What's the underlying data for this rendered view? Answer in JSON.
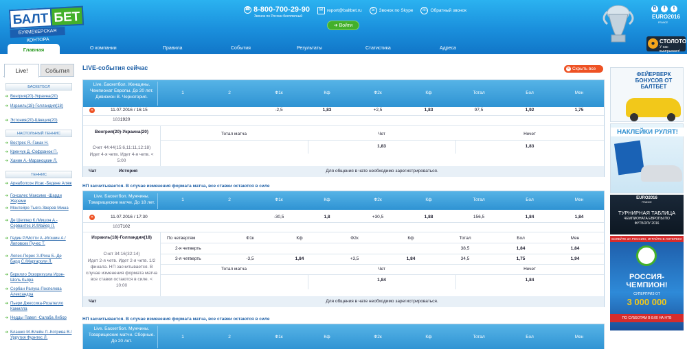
{
  "header": {
    "logo_word1": "БАЛТ",
    "logo_word2": "БЕТ",
    "logo_sub": "БУКМЕКЕРСКАЯ КОНТОРА",
    "phone": "8-800-700-29-90",
    "phone_note": "Звонок по России бесплатный",
    "email": "report@baltbet.ru",
    "skype": "Звонок по Skype",
    "callback": "Обратный звонок",
    "login": "➔ Войти",
    "euro": "EURO2016",
    "euro_country": "FRANCE",
    "stoloto": "СТОЛОТО",
    "stoloto_slogan": "У нас выигрывают!",
    "social": [
      "B",
      "f",
      "t"
    ]
  },
  "nav": {
    "items": [
      "Главная",
      "О компании",
      "Правила",
      "События",
      "Результаты",
      "Статистика",
      "Адреса"
    ]
  },
  "sidebar": {
    "tab_live": "Live!",
    "tab_events": "События",
    "cat_basketball": "БАСКЕТБОЛ",
    "basketball": [
      "Венгрия(20)-Украина(20)",
      "Израиль(18)-Голландия(18)",
      "Эстония(20)-Швеция(20)"
    ],
    "cat_tabletennis": "НАСТОЛЬНЫЙ ТЕННИС",
    "tabletennis": [
      "Вострес Я.-Ганак Н.",
      "Кренчук Д.-Софранюк П.",
      "Ханин А.-Мараноцкин Л."
    ],
    "cat_tennis": "ТЕННИС",
    "tennis": [
      "Арнаболсон Исак -Бедене Аляж",
      "Гонсалес Максимо -Шарди Жереми",
      "Монтейро Тьяго-Зверев Миша",
      "Де Шеппер К./Мишон А.-Сервантес И./Майер Л.",
      "Гедин Р./Мотти А.-Игошин А./Липовсек Пучес Т.",
      "Лопес-Перес З./Роха Б.-Де Бард С./Маргароли Л.",
      "Бурилло Эскорихуэла Ирэн-Шоль Кьяра",
      "Сербан Ралука-Поспелова Александра",
      "Пьери Джессика-Розателло Камилла",
      "Недды Павел -Салаба Либор",
      "Блашко М./Клейн Л.-Котрива В./Уррутия Фуэнтес Л."
    ]
  },
  "main": {
    "title": "LIVE-события сейчас",
    "hide_all": "Скрыть все",
    "cols": [
      "1",
      "2",
      "Ф1к",
      "Кф",
      "Ф2к",
      "Кф",
      "Тотал",
      "Бол",
      "Мен"
    ],
    "ev1": {
      "name": "Live. Баскетбол. Женщины. Чемпионат Европы. До 20 лет. Дивизион В. Черногория.",
      "date": "11.07.2016 / 16:15",
      "vals": [
        "-2,5",
        "1,83",
        "+2,5",
        "1,83",
        "97,5",
        "1,92",
        "1,75"
      ],
      "id1": "183",
      "id2": "1920",
      "match": "Венгрия(20)-Украина(20)",
      "score": "Счет 44:44(15:6,11:11,12:18)",
      "status": "Идет 4-я четв. Идет 4-я четв. < 5:00",
      "total_label": "Тотал матча",
      "even_label": "Чет",
      "odd_label": "Нечет",
      "even": "1,83",
      "odd": "1,83",
      "chat": "Чат",
      "history": "История",
      "chat_msg": "Для общения в чате необходимо зарегистрироваться."
    },
    "note": "НП засчитывается. В случае изменения формата матча, все ставки остаются в силе",
    "ev2": {
      "name": "Live. Баскетбол. Мужчины. Товарищеские матчи. До 18 лет.",
      "date": "11.07.2016 / 17:30",
      "vals": [
        "-30,5",
        "1,8",
        "+30,5",
        "1,88",
        "156,5",
        "1,84",
        "1,84"
      ],
      "id1": "183",
      "id2": "7102",
      "match": "Израиль(18)-Голландия(18)",
      "score": "Счет 34:16(32:14)",
      "status": "Идет 2-я четв. Идет 2-я четв. 1/2 финала. НП засчитывается. В случае изменения формата матча все ставки остаются в силе. < 10:00",
      "by_q": "По четвертям",
      "q_cols": [
        "Ф1к",
        "Кф",
        "Ф2к",
        "Кф",
        "Тотал",
        "Бол",
        "Мен"
      ],
      "q2": "2-я четверть",
      "q2_vals": [
        "38,5",
        "1,84",
        "1,84"
      ],
      "q3": "3-я четверть",
      "q3_vals": [
        "-3,5",
        "1,84",
        "+3,5",
        "1,84",
        "34,5",
        "1,75",
        "1,94"
      ],
      "even": "1,84",
      "odd": "1,84",
      "chat_msg": "Для общения в чате необходимо зарегистрироваться."
    },
    "ev3": {
      "name": "Live. Баскетбол. Мужчины. Товарищеские матчи. Сборные. До 20 лет."
    }
  },
  "banners": {
    "b1": "ФЕЙЕРВЕРК БОНУСОВ ОТ БАЛТБЕТ",
    "b2": "НАКЛЕЙКИ РУЛЯТ!",
    "b3_logo": "EURO2016",
    "b3_c": "FRANCE",
    "b3": "ТУРНИРНАЯ ТАБЛИЦА",
    "b3_sub": "ЧЕМПИОНАТА ЕВРОПЫ ПО ФУТБОЛУ 2016",
    "b4_top": "БОЛЕЙТЕ ЗА РОССИЮ, ИГРАЙТЕ В ЛОТЕРЕЮ!",
    "b4": "РОССИЯ-ЧЕМПИОН!",
    "b4_amt": "3 000 000",
    "b4_super": "СУПЕРПРИЗ ОТ",
    "b4_sub": "ПО СУББОТАМ В 8:00 НА НТВ"
  },
  "colors": {
    "accent_blue": "#1a8fdc",
    "green": "#43b02a",
    "orange": "#ee5224"
  }
}
